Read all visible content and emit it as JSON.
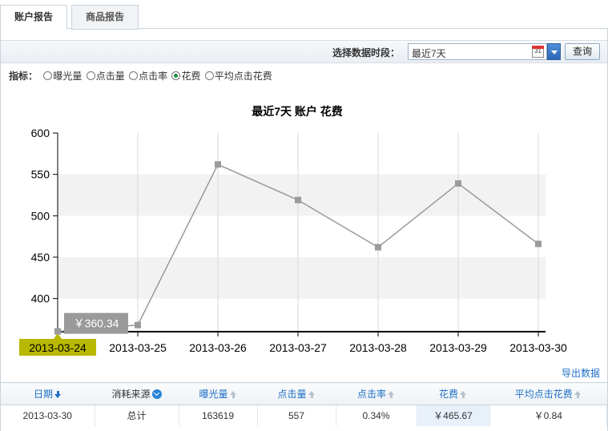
{
  "tabs": [
    {
      "label": "账户报告",
      "active": true
    },
    {
      "label": "商品报告",
      "active": false
    }
  ],
  "toolbar": {
    "period_label": "选择数据时段：",
    "period_value": "最近7天",
    "calendar_text": "31",
    "query_label": "查询"
  },
  "metrics": {
    "label": "指标：",
    "options": [
      {
        "label": "曝光量",
        "checked": false
      },
      {
        "label": "点击量",
        "checked": false
      },
      {
        "label": "点击率",
        "checked": false
      },
      {
        "label": "花费",
        "checked": true
      },
      {
        "label": "平均点击花费",
        "checked": false
      }
    ]
  },
  "chart_data": {
    "type": "line",
    "title": "最近7天 账户 花费",
    "categories": [
      "2013-03-24",
      "2013-03-25",
      "2013-03-26",
      "2013-03-27",
      "2013-03-28",
      "2013-03-29",
      "2013-03-30"
    ],
    "series": [
      {
        "values": [
          360.34,
          368,
          562,
          519,
          462,
          539,
          466
        ]
      }
    ],
    "yticks": [
      400,
      450,
      500,
      550,
      600
    ],
    "ylim": [
      360,
      600
    ],
    "grid": "alternating horizontal bands and vertical lines",
    "highlighted_index": 0,
    "tooltip": "￥360.34",
    "colors": {
      "line": "#9a9a9a",
      "marker": "#9a9a9a",
      "band": "#f2f2f2",
      "highlight_bg": "#b8b800",
      "tooltip_bg": "#9a9a9a"
    }
  },
  "export_label": "导出数据",
  "table": {
    "headers": [
      {
        "label": "日期",
        "sort": "down",
        "dark": false
      },
      {
        "label": "消耗来源",
        "sort": "info",
        "dark": true
      },
      {
        "label": "曝光量",
        "sort": "up",
        "dark": false
      },
      {
        "label": "点击量",
        "sort": "up",
        "dark": false
      },
      {
        "label": "点击率",
        "sort": "up",
        "dark": false
      },
      {
        "label": "花费",
        "sort": "up",
        "dark": false
      },
      {
        "label": "平均点击花费",
        "sort": "up",
        "dark": false
      }
    ],
    "rows": [
      [
        "2013-03-30",
        "总计",
        "163619",
        "557",
        "0.34%",
        "￥465.67",
        "￥0.84"
      ]
    ]
  }
}
